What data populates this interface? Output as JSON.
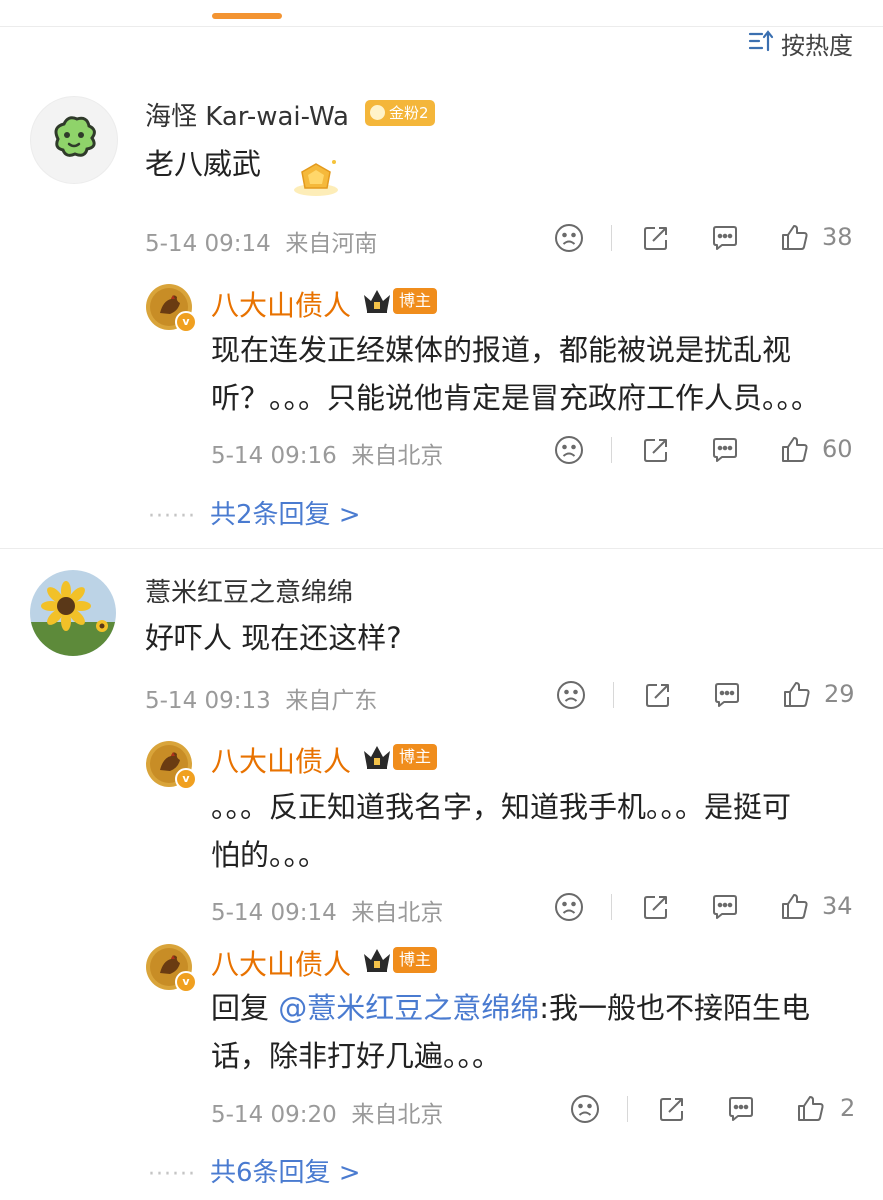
{
  "header": {
    "sort_label": "按热度",
    "accent": "#f39432"
  },
  "comments": [
    {
      "user": "海怪 Kar-wai-Wa",
      "badge": "金粉2",
      "text_lines": [
        "老八威武"
      ],
      "date": "5-14 09:14",
      "location": "来自河南",
      "likes": "38",
      "replies": [
        {
          "user": "八大山债人",
          "badge": "博主",
          "text_lines": [
            "现在连发正经媒体的报道，都能被说是扰乱视",
            "听？。。。只能说他肯定是冒充政府工作人员。。。"
          ],
          "date": "5-14 09:16",
          "location": "来自北京",
          "likes": "60"
        }
      ],
      "more_replies": "共2条回复 >"
    },
    {
      "user": "薏米红豆之意绵绵",
      "text_lines": [
        "好吓人 现在还这样?"
      ],
      "date": "5-14 09:13",
      "location": "来自广东",
      "likes": "29",
      "replies": [
        {
          "user": "八大山债人",
          "badge": "博主",
          "text_lines": [
            "。。。反正知道我名字，知道我手机。。。是挺可",
            "怕的。。。"
          ],
          "date": "5-14 09:14",
          "location": "来自北京",
          "likes": "34"
        },
        {
          "user": "八大山债人",
          "badge": "博主",
          "reply_prefix": "回复",
          "mention": "@薏米红豆之意绵绵",
          "text_first": ":我一般也不接陌生电",
          "text_second": "话，除非打好几遍。。。",
          "date": "5-14 09:20",
          "location": "来自北京",
          "likes": "2"
        }
      ],
      "more_replies": "共6条回复 >"
    }
  ],
  "icons": {
    "dislike": "sad-face-icon",
    "share": "share-icon",
    "comment": "comment-icon",
    "like": "thumbs-up-icon"
  },
  "colors": {
    "author": "#e87200",
    "link": "#4a7bd0",
    "meta": "#9a9a9a"
  }
}
